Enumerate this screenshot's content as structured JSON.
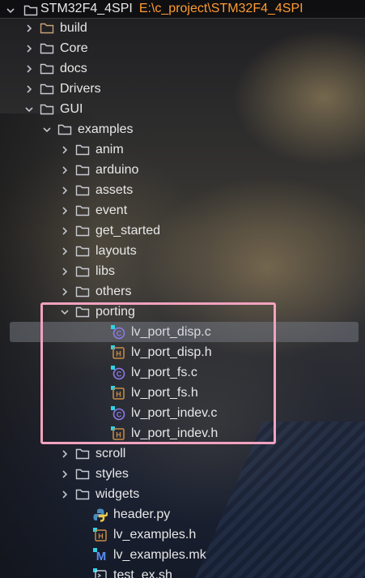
{
  "project": {
    "name": "STM32F4_4SPI",
    "path": "E:\\c_project\\STM32F4_4SPI"
  },
  "tree": [
    {
      "label": "build",
      "type": "folder",
      "expanded": false,
      "depth": 1,
      "muted": true
    },
    {
      "label": "Core",
      "type": "folder",
      "expanded": false,
      "depth": 1
    },
    {
      "label": "docs",
      "type": "folder",
      "expanded": false,
      "depth": 1
    },
    {
      "label": "Drivers",
      "type": "folder",
      "expanded": false,
      "depth": 1
    },
    {
      "label": "GUI",
      "type": "folder",
      "expanded": true,
      "depth": 1
    },
    {
      "label": "examples",
      "type": "folder",
      "expanded": true,
      "depth": 2
    },
    {
      "label": "anim",
      "type": "folder",
      "expanded": false,
      "depth": 3
    },
    {
      "label": "arduino",
      "type": "folder",
      "expanded": false,
      "depth": 3
    },
    {
      "label": "assets",
      "type": "folder",
      "expanded": false,
      "depth": 3
    },
    {
      "label": "event",
      "type": "folder",
      "expanded": false,
      "depth": 3
    },
    {
      "label": "get_started",
      "type": "folder",
      "expanded": false,
      "depth": 3
    },
    {
      "label": "layouts",
      "type": "folder",
      "expanded": false,
      "depth": 3
    },
    {
      "label": "libs",
      "type": "folder",
      "expanded": false,
      "depth": 3
    },
    {
      "label": "others",
      "type": "folder",
      "expanded": false,
      "depth": 3
    },
    {
      "label": "porting",
      "type": "folder",
      "expanded": true,
      "depth": 3
    },
    {
      "label": "lv_port_disp.c",
      "type": "c-file",
      "depth": 4,
      "selected": true
    },
    {
      "label": "lv_port_disp.h",
      "type": "h-file",
      "depth": 4
    },
    {
      "label": "lv_port_fs.c",
      "type": "c-file",
      "depth": 4
    },
    {
      "label": "lv_port_fs.h",
      "type": "h-file",
      "depth": 4
    },
    {
      "label": "lv_port_indev.c",
      "type": "c-file",
      "depth": 4
    },
    {
      "label": "lv_port_indev.h",
      "type": "h-file",
      "depth": 4
    },
    {
      "label": "scroll",
      "type": "folder",
      "expanded": false,
      "depth": 3
    },
    {
      "label": "styles",
      "type": "folder",
      "expanded": false,
      "depth": 3
    },
    {
      "label": "widgets",
      "type": "folder",
      "expanded": false,
      "depth": 3
    },
    {
      "label": "header.py",
      "type": "py-file",
      "depth": 3
    },
    {
      "label": "lv_examples.h",
      "type": "h-file",
      "depth": 3
    },
    {
      "label": "lv_examples.mk",
      "type": "mk-file",
      "depth": 3
    },
    {
      "label": "test_ex.sh",
      "type": "sh-file",
      "depth": 3
    }
  ],
  "colors": {
    "path": "#ff9b2f",
    "highlight": "#f2a2bf",
    "folder_icon": "#c9ccd3",
    "c_icon": "#8c7ae6",
    "h_icon": "#c98b45",
    "modified_marker": "#2fd3e8"
  }
}
